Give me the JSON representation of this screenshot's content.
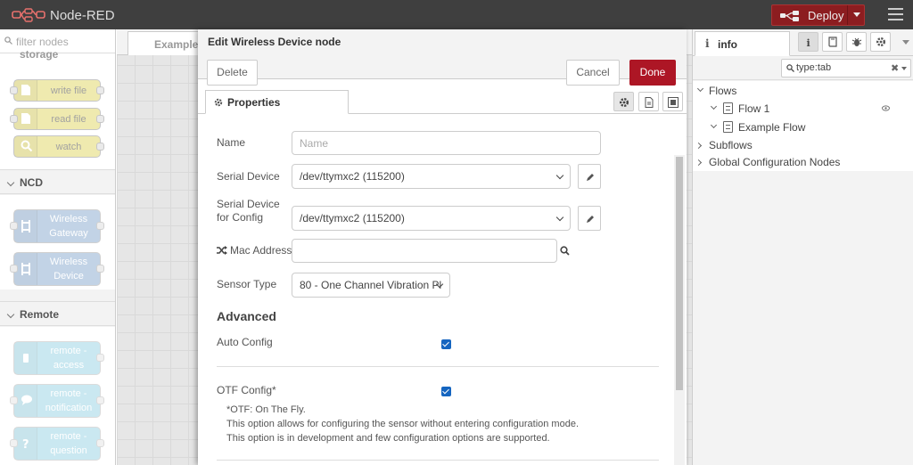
{
  "header": {
    "app_name": "Node-RED",
    "deploy_label": "Deploy"
  },
  "palette": {
    "search_placeholder": "filter nodes",
    "categories": [
      {
        "name": "storage",
        "nodes": [
          "write file",
          "read file",
          "watch"
        ]
      },
      {
        "name": "NCD",
        "nodes": [
          "Wireless Gateway",
          "Wireless Device"
        ]
      },
      {
        "name": "Remote",
        "nodes": [
          "remote - access",
          "remote - notification",
          "remote - question"
        ]
      }
    ]
  },
  "workspace": {
    "tab_label": "Example"
  },
  "editor": {
    "title": "Edit Wireless Device node",
    "delete_label": "Delete",
    "cancel_label": "Cancel",
    "done_label": "Done",
    "properties_tab": "Properties",
    "fields": {
      "name_label": "Name",
      "name_placeholder": "Name",
      "serial_device_label": "Serial Device",
      "serial_device_value": "/dev/ttymxc2 (115200)",
      "serial_config_label_1": "Serial Device",
      "serial_config_label_2": "for Config",
      "serial_config_value": "/dev/ttymxc2 (115200)",
      "mac_label": "Mac Address",
      "mac_value": "",
      "sensor_type_label": "Sensor Type",
      "sensor_type_value": "80 - One Channel Vibration Pl"
    },
    "advanced": {
      "heading": "Advanced",
      "auto_config_label": "Auto Config",
      "auto_config_checked": true,
      "otf_label": "OTF Config*",
      "otf_checked": true,
      "notes": [
        "*OTF: On The Fly.",
        "This option allows for configuring the sensor without entering configuration mode.",
        "This option is in development and few configuration options are supported."
      ]
    }
  },
  "sidebar": {
    "tab_label": "info",
    "search_value": "type:tab",
    "tree": {
      "flows_label": "Flows",
      "flows": [
        "Flow 1",
        "Example Flow"
      ],
      "subflows_label": "Subflows",
      "global_config_label": "Global Configuration Nodes"
    }
  },
  "colors": {
    "header_bg": "#3f3f3f",
    "deploy_bg": "#8c1d20",
    "done_bg": "#ad1625",
    "checkbox": "#1565c0"
  }
}
